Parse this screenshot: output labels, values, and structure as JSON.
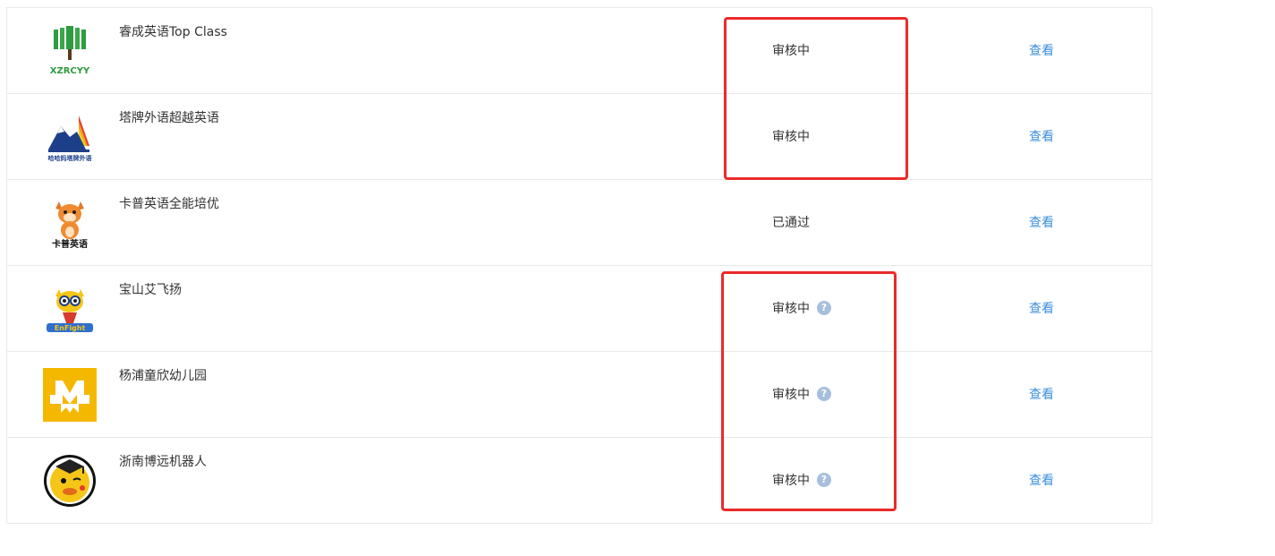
{
  "institutions": [
    {
      "name": "睿成英语Top Class",
      "status": "审核中",
      "has_help": false,
      "action": "查看",
      "logo_icon": "xzrcyy-tree-logo",
      "logo_text": "XZRCYY"
    },
    {
      "name": "塔牌外语超越英语",
      "status": "审核中",
      "has_help": false,
      "action": "查看",
      "logo_icon": "tower-sail-logo",
      "logo_text": "哈哈妈塔牌外语"
    },
    {
      "name": "卡普英语全能培优",
      "status": "已通过",
      "has_help": false,
      "action": "查看",
      "logo_icon": "kapu-cartoon-logo",
      "logo_text": "卡普英语"
    },
    {
      "name": "宝山艾飞扬",
      "status": "审核中",
      "has_help": true,
      "action": "查看",
      "logo_icon": "enfight-mascot-logo",
      "logo_text": "EnFight"
    },
    {
      "name": "杨浦童欣幼儿园",
      "status": "审核中",
      "has_help": true,
      "action": "查看",
      "logo_icon": "yellow-m-logo",
      "logo_text": ""
    },
    {
      "name": "浙南博远机器人",
      "status": "审核中",
      "has_help": true,
      "action": "查看",
      "logo_icon": "duck-graduate-logo",
      "logo_text": ""
    }
  ],
  "help_icon_glyph": "?",
  "colors": {
    "link": "#3c8fdc",
    "annotation": "#ec2a2a",
    "help_icon": "#a7bfdc",
    "divider": "#e8e8e8"
  }
}
